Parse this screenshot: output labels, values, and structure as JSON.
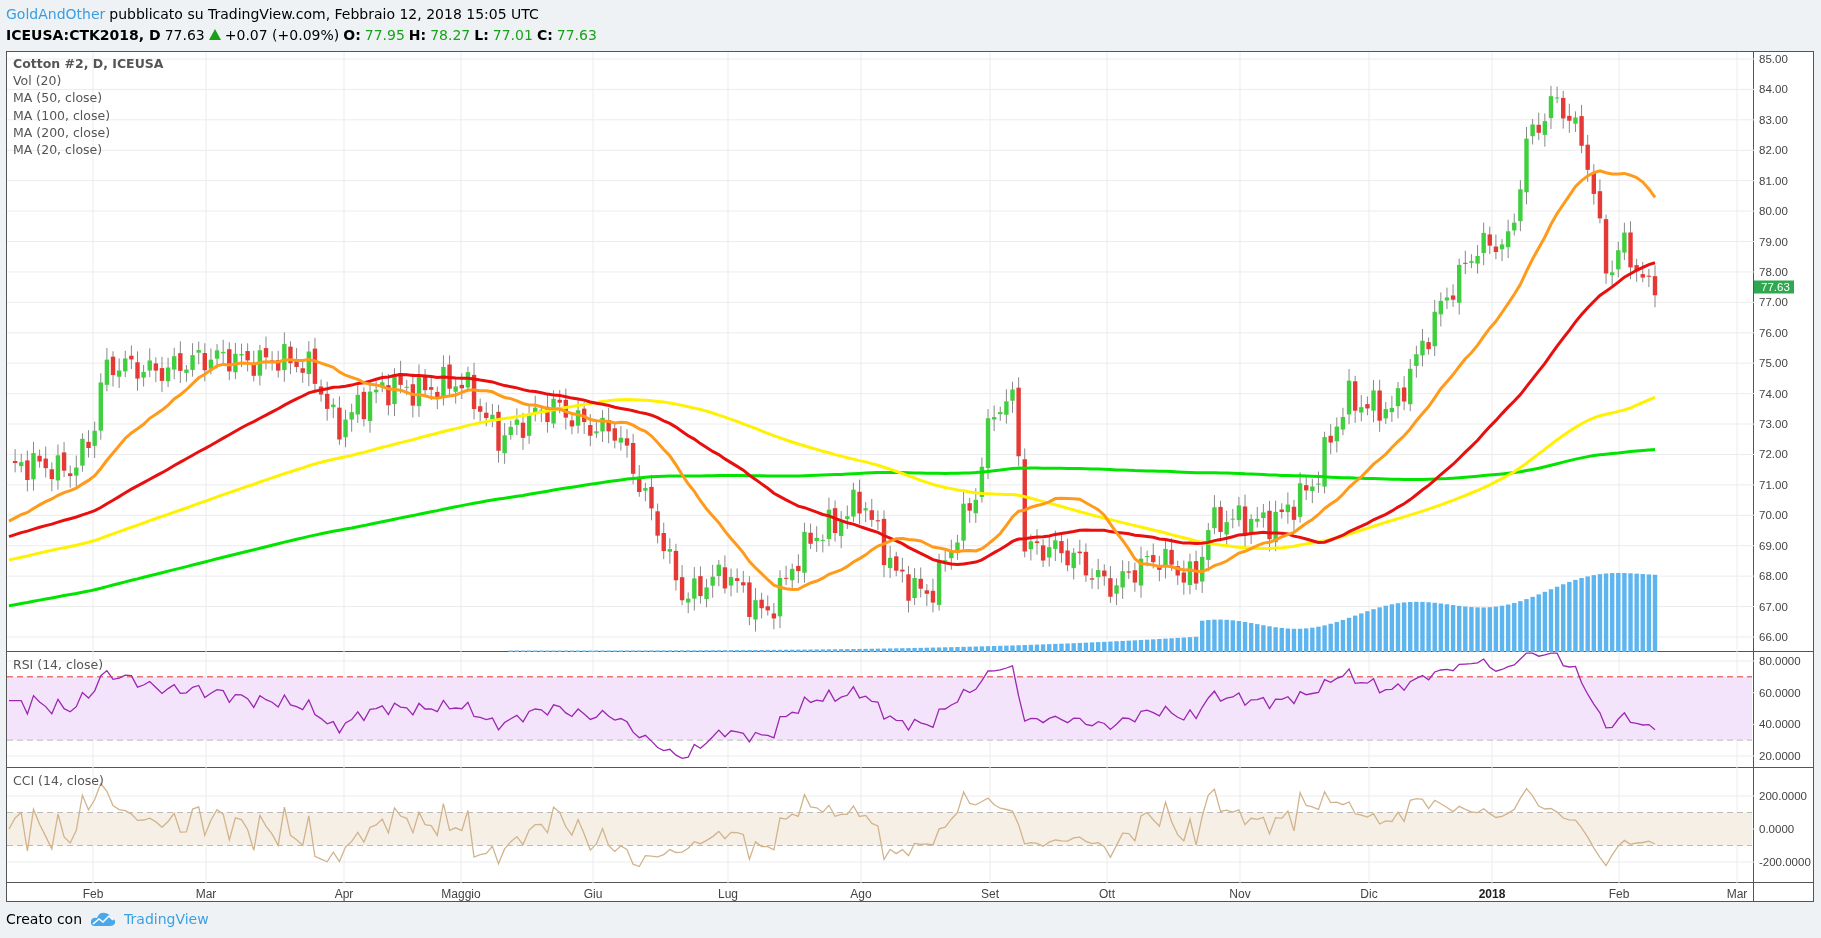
{
  "header": {
    "author": "GoldAndOther",
    "published": "pubblicato su TradingView.com, Febbraio 12, 2018 15:05 UTC"
  },
  "quote": {
    "symbol": "ICEUSA:CTK2018, D",
    "last": "77.63",
    "rising": true,
    "change": "+0.07 (+0.09%)",
    "ohlc": [
      {
        "label": "O:",
        "value": "77.95"
      },
      {
        "label": "H:",
        "value": "78.27"
      },
      {
        "label": "L:",
        "value": "77.01"
      },
      {
        "label": "C:",
        "value": "77.63"
      }
    ]
  },
  "main_pane": {
    "legend": [
      "Cotton #2, D, ICEUSA",
      "Vol (20)",
      "MA (50, close)",
      "MA (100, close)",
      "MA (200, close)",
      "MA (20, close)"
    ],
    "price_axis": [
      "85.00",
      "84.00",
      "83.00",
      "82.00",
      "81.00",
      "80.00",
      "79.00",
      "78.00",
      "77.00",
      "76.00",
      "75.00",
      "74.00",
      "73.00",
      "72.00",
      "71.00",
      "70.00",
      "69.00",
      "68.00",
      "67.00",
      "66.00"
    ],
    "last_price_tag": "77.63"
  },
  "rsi_pane": {
    "legend": "RSI (14, close)",
    "axis": [
      "80.0000",
      "60.0000",
      "40.0000",
      "20.0000"
    ]
  },
  "cci_pane": {
    "legend": "CCI (14, close)",
    "axis": [
      "200.0000",
      "0.0000",
      "-200.0000"
    ]
  },
  "time_axis": [
    {
      "label": "Feb",
      "year": false
    },
    {
      "label": "Mar",
      "year": false
    },
    {
      "label": "Apr",
      "year": false
    },
    {
      "label": "Maggio",
      "year": false
    },
    {
      "label": "Giu",
      "year": false
    },
    {
      "label": "Lug",
      "year": false
    },
    {
      "label": "Ago",
      "year": false
    },
    {
      "label": "Set",
      "year": false
    },
    {
      "label": "Ott",
      "year": false
    },
    {
      "label": "Nov",
      "year": false
    },
    {
      "label": "Dic",
      "year": false
    },
    {
      "label": "2018",
      "year": true
    },
    {
      "label": "Feb",
      "year": false
    },
    {
      "label": "Mar",
      "year": false
    }
  ],
  "footer": {
    "text": "Creato con",
    "brand": "TradingView"
  }
}
